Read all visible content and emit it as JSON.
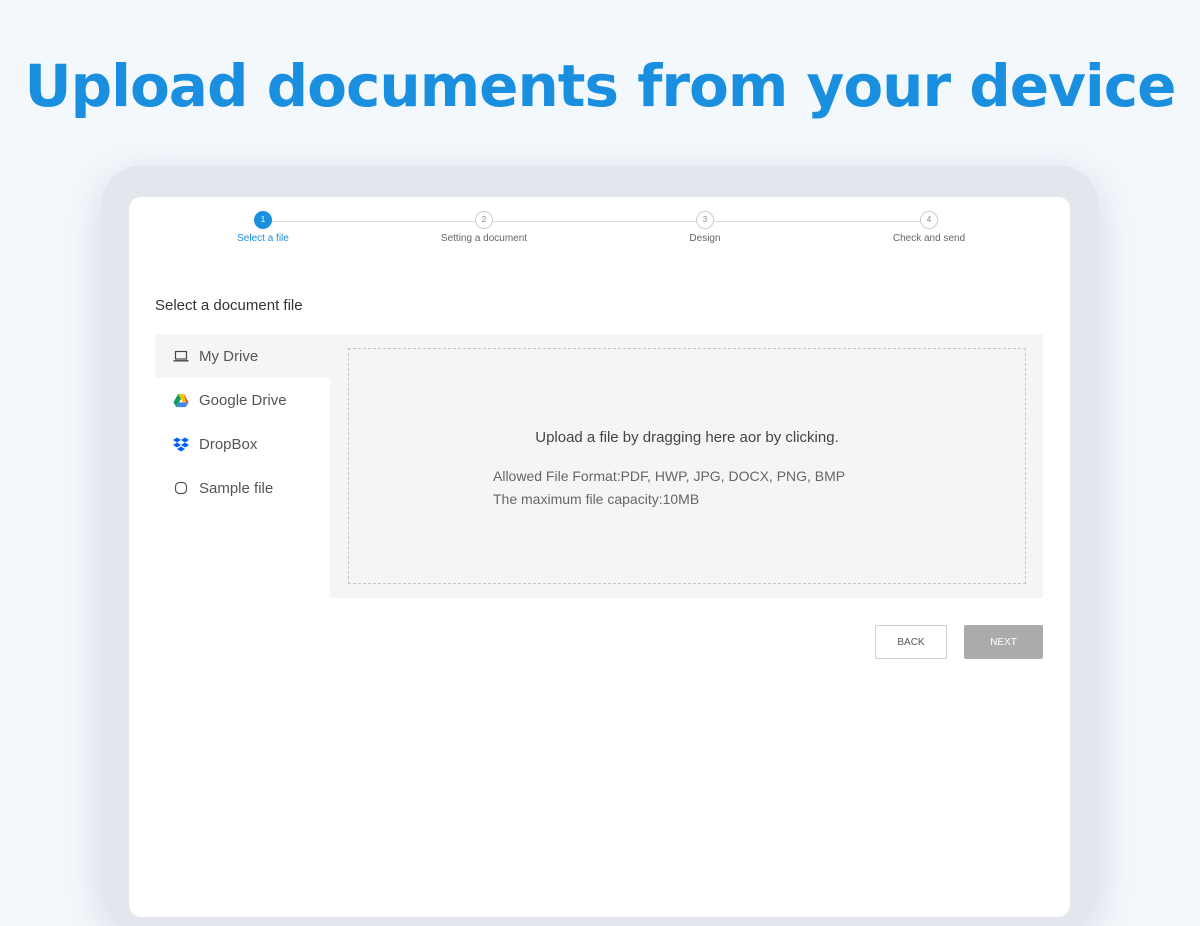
{
  "headline": "Upload documents from your device",
  "colors": {
    "accent": "#1a8fe0",
    "background": "#f3f8fc",
    "device_frame": "#e3e6ec",
    "next_disabled": "#ababab"
  },
  "stepper": {
    "steps": [
      {
        "number": "1",
        "label": "Select a file",
        "active": true
      },
      {
        "number": "2",
        "label": "Setting a document",
        "active": false
      },
      {
        "number": "3",
        "label": "Design",
        "active": false
      },
      {
        "number": "4",
        "label": "Check and send",
        "active": false
      }
    ]
  },
  "section_title": "Select a document file",
  "sources": [
    {
      "label": "My Drive",
      "icon": "laptop-icon",
      "selected": true
    },
    {
      "label": "Google Drive",
      "icon": "google-drive-icon",
      "selected": false
    },
    {
      "label": "DropBox",
      "icon": "dropbox-icon",
      "selected": false
    },
    {
      "label": "Sample file",
      "icon": "sample-file-icon",
      "selected": false
    }
  ],
  "dropzone": {
    "main_text": "Upload a file by dragging here aor by clicking.",
    "allowed_formats": "Allowed File Format:PDF, HWP, JPG, DOCX, PNG, BMP",
    "max_capacity": "The maximum file capacity:10MB"
  },
  "buttons": {
    "back_label": "BACK",
    "next_label": "NEXT"
  }
}
